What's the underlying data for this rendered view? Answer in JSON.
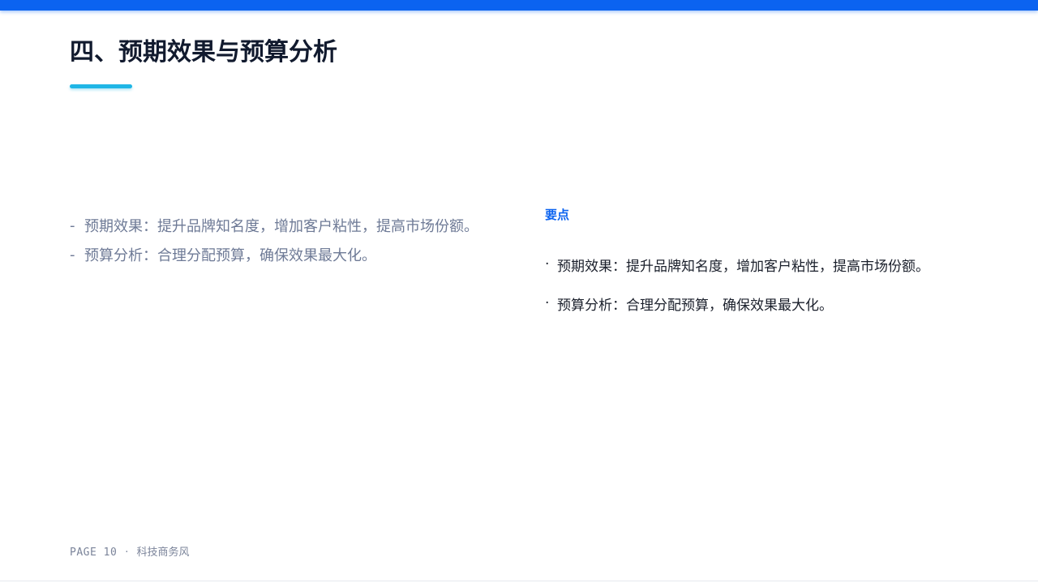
{
  "slide": {
    "title": "四、预期效果与预算分析",
    "accent_color": "#0b63f0",
    "underline_color": "#1fb6e6"
  },
  "left_list": {
    "marker": "-",
    "items": [
      "预期效果：提升品牌知名度，增加客户粘性，提高市场份额。",
      "预算分析：合理分配预算，确保效果最大化。"
    ]
  },
  "right_panel": {
    "heading": "要点",
    "marker": "·",
    "items": [
      "预期效果：提升品牌知名度，增加客户粘性，提高市场份额。",
      "预算分析：合理分配预算，确保效果最大化。"
    ]
  },
  "footer": {
    "page_label": "PAGE 10",
    "separator": "·",
    "style_label": "科技商务风"
  }
}
